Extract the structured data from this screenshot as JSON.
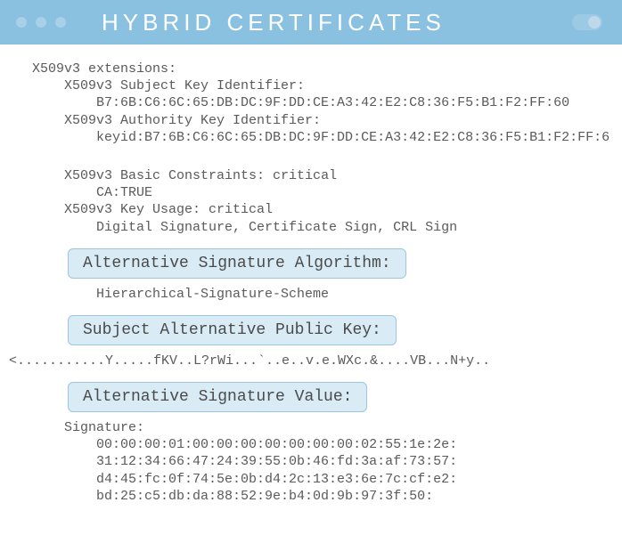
{
  "header": {
    "title": "HYBRID CERTIFICATES"
  },
  "ext": {
    "heading": "X509v3 extensions:",
    "ski_label": "X509v3 Subject Key Identifier:",
    "ski_value": "B7:6B:C6:6C:65:DB:DC:9F:DD:CE:A3:42:E2:C8:36:F5:B1:F2:FF:60",
    "aki_label": "X509v3 Authority Key Identifier:",
    "aki_value": "keyid:B7:6B:C6:6C:65:DB:DC:9F:DD:CE:A3:42:E2:C8:36:F5:B1:F2:FF:6",
    "bc_label": "X509v3 Basic Constraints: critical",
    "bc_value": "CA:TRUE",
    "ku_label": "X509v3 Key Usage: critical",
    "ku_value": "Digital Signature, Certificate Sign, CRL Sign"
  },
  "badges": {
    "alg": "Alternative Signature Algorithm:",
    "pub": "Subject Alternative Public Key:",
    "val": "Alternative Signature Value:"
  },
  "alg_value": "Hierarchical-Signature-Scheme",
  "pub_value": "<...........Y.....fKV..L?rWi...`..e..v.e.WXc.&....VB...N+y..",
  "sig": {
    "label": "Signature:",
    "l1": "00:00:00:01:00:00:00:00:00:00:00:02:55:1e:2e:",
    "l2": "31:12:34:66:47:24:39:55:0b:46:fd:3a:af:73:57:",
    "l3": "d4:45:fc:0f:74:5e:0b:d4:2c:13:e3:6e:7c:cf:e2:",
    "l4": "bd:25:c5:db:da:88:52:9e:b4:0d:9b:97:3f:50:"
  }
}
